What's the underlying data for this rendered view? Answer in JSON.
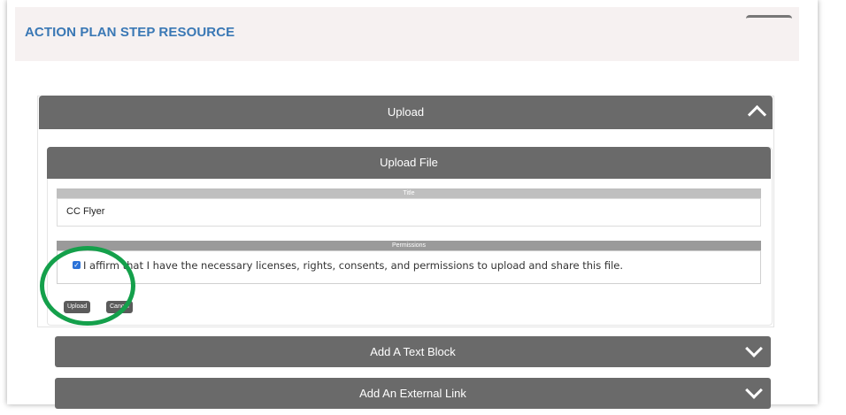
{
  "header": {
    "title": "ACTION PLAN STEP RESOURCE"
  },
  "upload_section": {
    "label": "Upload"
  },
  "upload_file": {
    "label": "Upload File",
    "title_field": {
      "label": "Title",
      "value": "CC Flyer"
    },
    "permissions": {
      "label": "Permissions",
      "checked": true,
      "statement": "I affirm that I have the necessary licenses, rights, consents, and permissions to upload and share this file."
    },
    "buttons": {
      "upload": "Upload",
      "cancel": "Cancel"
    }
  },
  "text_block_section": {
    "label": "Add A Text Block"
  },
  "external_link_section": {
    "label": "Add An External Link"
  },
  "annotation": {
    "circle_color": "#14a04b"
  },
  "colors": {
    "accent": "#3a78b5",
    "bar": "#6a6a6a",
    "checkbox": "#2b72d8"
  }
}
